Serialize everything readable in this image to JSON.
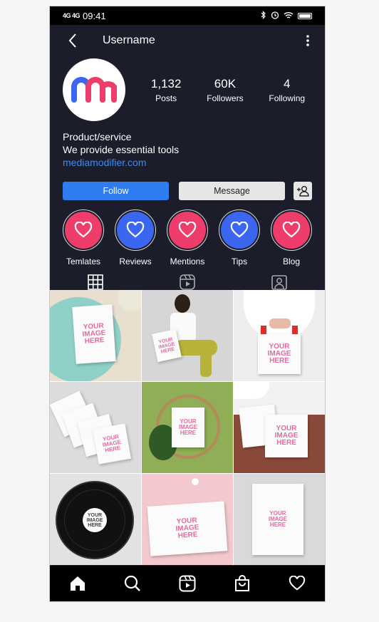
{
  "status": {
    "signal": "4G 4G",
    "time": "09:41"
  },
  "header": {
    "username": "Username"
  },
  "profile": {
    "stats": [
      {
        "num": "1,132",
        "label": "Posts"
      },
      {
        "num": "60K",
        "label": "Followers"
      },
      {
        "num": "4",
        "label": "Following"
      }
    ],
    "bio_category": "Product/service",
    "bio_text": "We provide essential tools",
    "bio_link": "mediamodifier.com"
  },
  "actions": {
    "follow_label": "Follow",
    "message_label": "Message"
  },
  "highlights": [
    {
      "label": "Temlates",
      "color": "#ee3c6b"
    },
    {
      "label": "Reviews",
      "color": "#3a66f0"
    },
    {
      "label": "Mentions",
      "color": "#ee3c6b"
    },
    {
      "label": "Tips",
      "color": "#3a66f0"
    },
    {
      "label": "Blog",
      "color": "#ee3c6b"
    }
  ],
  "tabs": [
    "grid-icon",
    "reels-icon",
    "tagged-icon"
  ],
  "posts": [
    {
      "mock_text": "YOUR IMAGE HERE",
      "bg": "#e9dfcf"
    },
    {
      "mock_text": "YOUR IMAGE HERE",
      "bg": "#d6d6d6"
    },
    {
      "mock_text": "YOUR IMAGE HERE",
      "bg": "#eeeeee"
    },
    {
      "mock_text": "YOUR IMAGE HERE",
      "bg": "#dcdcdc"
    },
    {
      "mock_text": "YOUR IMAGE HERE",
      "bg": "#8fae55"
    },
    {
      "mock_text": "YOUR IMAGE HERE",
      "bg": "#8a4a3a"
    },
    {
      "mock_text": "YOUR IMAGE HERE",
      "bg": "#e2e2e2"
    },
    {
      "mock_text": "YOUR IMAGE HERE",
      "bg": "#f3c9cf"
    },
    {
      "mock_text": "YOUR IMAGE HERE",
      "bg": "#d9d9d9"
    }
  ],
  "bottom_nav": [
    "home-icon",
    "search-icon",
    "reels-icon",
    "shop-icon",
    "heart-icon"
  ],
  "colors": {
    "background": "#1b1d2b",
    "accent": "#2f7bf0",
    "link": "#3a8cf0"
  }
}
